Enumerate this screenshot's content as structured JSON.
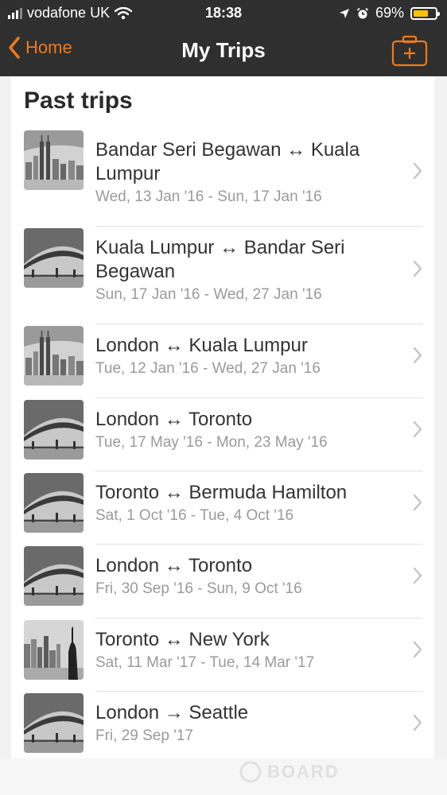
{
  "status_bar": {
    "carrier": "vodafone UK",
    "time": "18:38",
    "battery_percent": "69%",
    "battery_level": 0.69,
    "battery_color": "#ffc400",
    "icons": [
      "signal-bars-icon",
      "wifi-icon",
      "location-arrow-icon",
      "alarm-clock-icon",
      "battery-icon"
    ]
  },
  "nav": {
    "back_label": "Home",
    "title": "My Trips",
    "add_icon": "suitcase-plus-icon",
    "accent_color": "#f07a1c"
  },
  "section_title": "Past trips",
  "trips": [
    {
      "title": "Bandar Seri Begawan ↔ Kuala Lumpur",
      "dates": "Wed, 13 Jan '16 - Sun, 17 Jan '16",
      "thumb": "city-skyline"
    },
    {
      "title": "Kuala Lumpur ↔ Bandar Seri Begawan",
      "dates": "Sun, 17 Jan '16 - Wed, 27 Jan '16",
      "thumb": "bridge"
    },
    {
      "title": "London ↔ Kuala Lumpur",
      "dates": "Tue, 12 Jan '16 - Wed, 27 Jan '16",
      "thumb": "city-skyline"
    },
    {
      "title": "London ↔ Toronto",
      "dates": "Tue, 17 May '16 - Mon, 23 May '16",
      "thumb": "bridge"
    },
    {
      "title": "Toronto ↔ Bermuda Hamilton",
      "dates": "Sat, 1 Oct '16 - Tue, 4 Oct '16",
      "thumb": "bridge"
    },
    {
      "title": "London ↔ Toronto",
      "dates": "Fri, 30 Sep '16 - Sun, 9 Oct '16",
      "thumb": "bridge"
    },
    {
      "title": "Toronto ↔ New York",
      "dates": "Sat, 11 Mar '17 - Tue, 14 Mar '17",
      "thumb": "statue-of-liberty"
    },
    {
      "title": "London → Seattle",
      "dates": "Fri, 29 Sep '17",
      "thumb": "bridge"
    }
  ],
  "watermark": "BOARD"
}
